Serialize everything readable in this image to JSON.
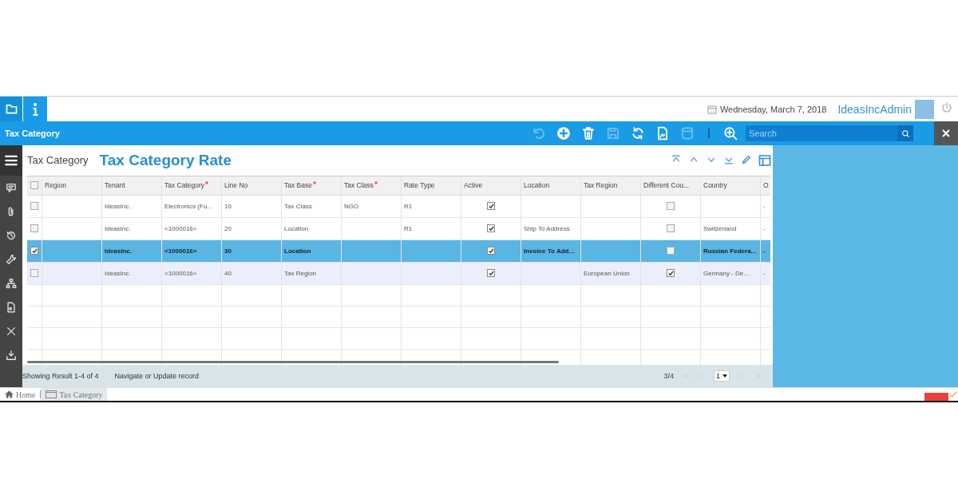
{
  "header": {
    "tabs": [
      {
        "kind": "folder",
        "selected": true
      },
      {
        "kind": "info",
        "selected": false
      }
    ],
    "date": "Wednesday, March 7, 2018",
    "user": "IdeasIncAdmin"
  },
  "window": {
    "title": "Tax Category"
  },
  "toolbar": [
    {
      "kind": "undo",
      "disabled": true
    },
    {
      "kind": "add",
      "disabled": false
    },
    {
      "kind": "delete",
      "disabled": false
    },
    {
      "kind": "save",
      "disabled": true
    },
    {
      "kind": "refresh",
      "disabled": false
    },
    {
      "kind": "report",
      "disabled": false
    },
    {
      "kind": "database",
      "disabled": true
    },
    {
      "kind": "zoom",
      "disabled": false
    }
  ],
  "search": {
    "placeholder": "Search"
  },
  "breadcrumb_title": "Tax Category",
  "tab_title": "Tax Category Rate",
  "table": {
    "select_all_checked": false,
    "columns": [
      {
        "label": "Region",
        "required": false,
        "kind": "text"
      },
      {
        "label": "Tenant",
        "required": false,
        "kind": "text"
      },
      {
        "label": "Tax Category",
        "required": true,
        "kind": "text"
      },
      {
        "label": "Line No",
        "required": false,
        "kind": "text"
      },
      {
        "label": "Tax Base",
        "required": true,
        "kind": "text"
      },
      {
        "label": "Tax Class",
        "required": true,
        "kind": "text"
      },
      {
        "label": "Rate Type",
        "required": false,
        "kind": "text"
      },
      {
        "label": "Active",
        "required": false,
        "kind": "check"
      },
      {
        "label": "Location",
        "required": false,
        "kind": "text"
      },
      {
        "label": "Tax Region",
        "required": false,
        "kind": "text"
      },
      {
        "label": "Different Cou...",
        "required": false,
        "kind": "check"
      },
      {
        "label": "Country",
        "required": false,
        "kind": "text"
      },
      {
        "label": "O",
        "kind": "text"
      }
    ],
    "rows": [
      {
        "selected": false,
        "hovered": false,
        "cells": [
          null,
          "IdeasInc.",
          "Electronics (Fu...",
          "10",
          "Tax Class",
          "NGO",
          "R1",
          {
            "checked": true
          },
          null,
          null,
          {
            "checked": false
          },
          null,
          "-"
        ]
      },
      {
        "selected": false,
        "hovered": false,
        "cells": [
          null,
          "IdeasInc.",
          "<1000016>",
          "20",
          "Location",
          null,
          "R1",
          {
            "checked": true
          },
          "Ship To Address",
          null,
          {
            "checked": false
          },
          "Switzerland",
          "-"
        ]
      },
      {
        "selected": true,
        "hovered": false,
        "cells": [
          null,
          "IdeasInc.",
          "<1000016>",
          "30",
          "Location",
          null,
          null,
          {
            "checked": true
          },
          "Invoice To Add...",
          null,
          {
            "checked": false
          },
          "Russian Federa...",
          "-"
        ]
      },
      {
        "selected": false,
        "hovered": true,
        "cells": [
          null,
          "IdeasInc.",
          "<1000016>",
          "40",
          "Tax Region",
          null,
          null,
          {
            "checked": true
          },
          null,
          "European Union",
          {
            "checked": true
          },
          "Germany - De...",
          "-"
        ]
      }
    ]
  },
  "status_bar": {
    "result": "Showing Result 1-4 of 4",
    "message": "Navigate or Update record",
    "record": "3/4",
    "page": "1"
  },
  "footer": {
    "items": [
      {
        "label": "Home",
        "kind": "home",
        "selected": false
      },
      {
        "label": "Tax Category",
        "kind": "window",
        "selected": true
      }
    ]
  }
}
